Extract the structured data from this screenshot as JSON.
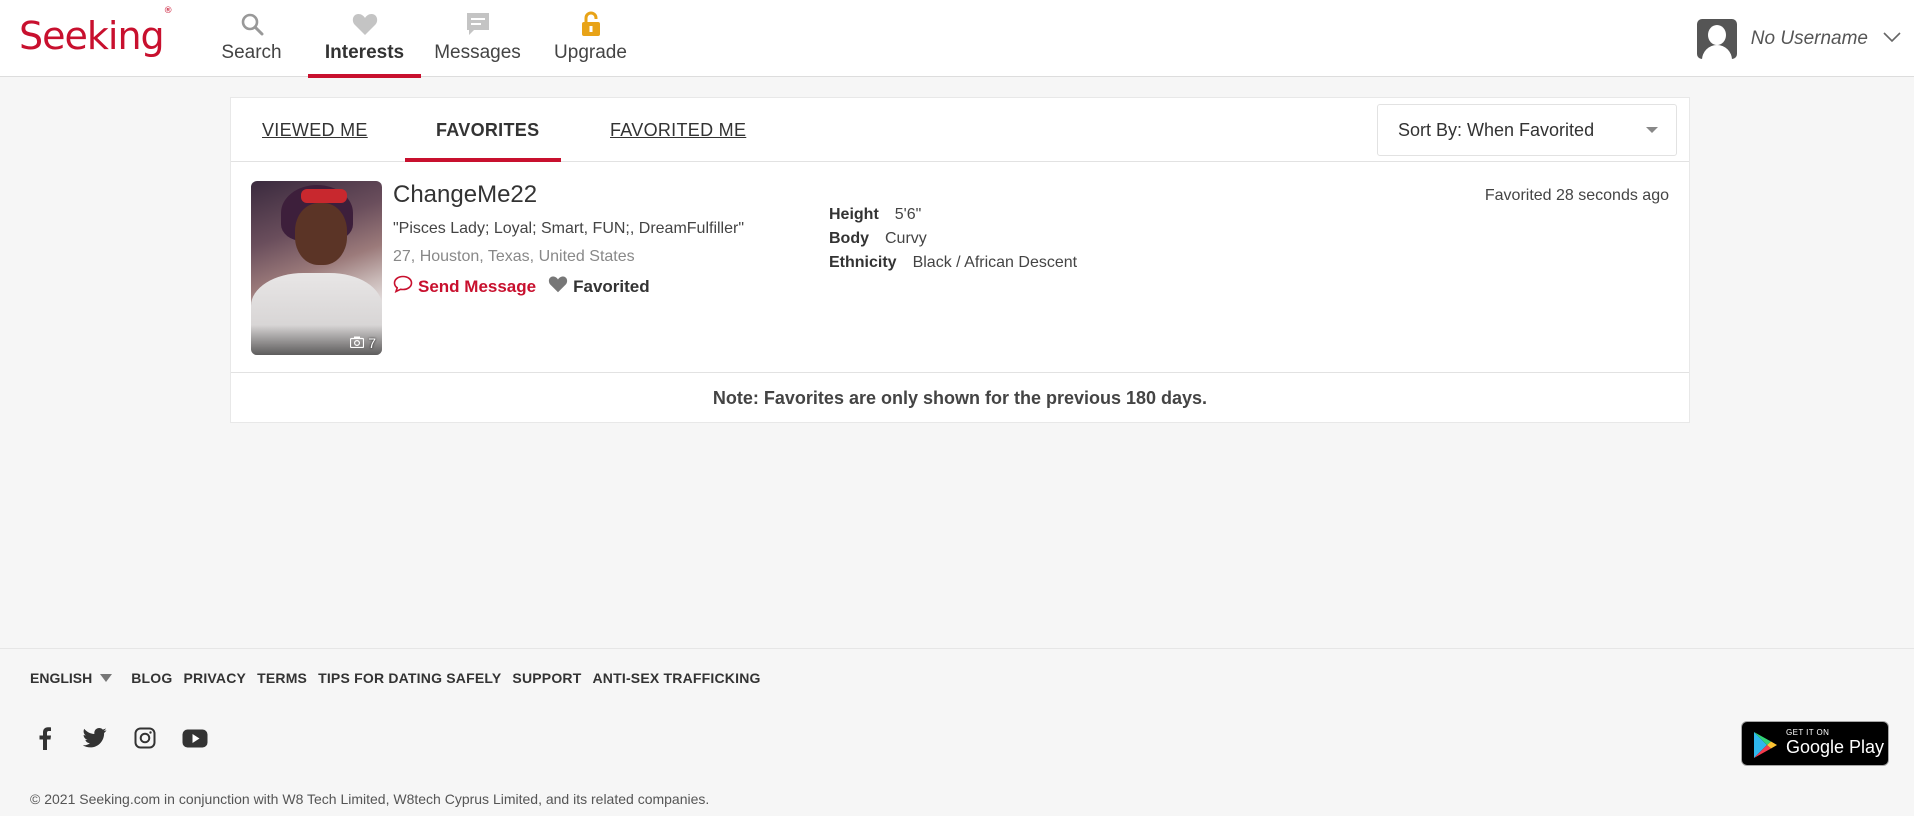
{
  "header": {
    "logo": "Seeking",
    "logo_mark": "®",
    "nav": [
      {
        "label": "Search",
        "icon": "search-icon"
      },
      {
        "label": "Interests",
        "icon": "heart-icon",
        "active": true
      },
      {
        "label": "Messages",
        "icon": "message-icon"
      },
      {
        "label": "Upgrade",
        "icon": "lock-icon"
      }
    ],
    "username": "No Username"
  },
  "tabs": [
    {
      "label": "VIEWED ME"
    },
    {
      "label": "FAVORITES",
      "active": true
    },
    {
      "label": "FAVORITED ME"
    }
  ],
  "sort": {
    "label": "Sort By: When Favorited"
  },
  "profile": {
    "name": "ChangeMe22",
    "tagline": "\"Pisces Lady; Loyal; Smart, FUN;, DreamFulfiller\"",
    "location": "27, Houston, Texas, United States",
    "photo_count": "7",
    "send_message": "Send Message",
    "favorited": "Favorited",
    "favorited_time": "Favorited 28 seconds ago",
    "attributes": [
      {
        "key": "Height",
        "value": "5'6\""
      },
      {
        "key": "Body",
        "value": "Curvy"
      },
      {
        "key": "Ethnicity",
        "value": "Black / African Descent"
      }
    ]
  },
  "note": "Note: Favorites are only shown for the previous 180 days.",
  "footer": {
    "language": "ENGLISH",
    "links": [
      "BLOG",
      "PRIVACY",
      "TERMS",
      "TIPS FOR DATING SAFELY",
      "SUPPORT",
      "ANTI-SEX TRAFFICKING"
    ],
    "socials": [
      "facebook-icon",
      "twitter-icon",
      "instagram-icon",
      "youtube-icon"
    ],
    "google_play_small": "GET IT ON",
    "google_play_big": "Google Play",
    "copyright": "© 2021 Seeking.com in conjunction with W8 Tech Limited, W8tech Cyprus Limited, and its related companies."
  },
  "colors": {
    "accent": "#c8102e",
    "background": "#f6f6f6",
    "lock": "#e8a317"
  }
}
